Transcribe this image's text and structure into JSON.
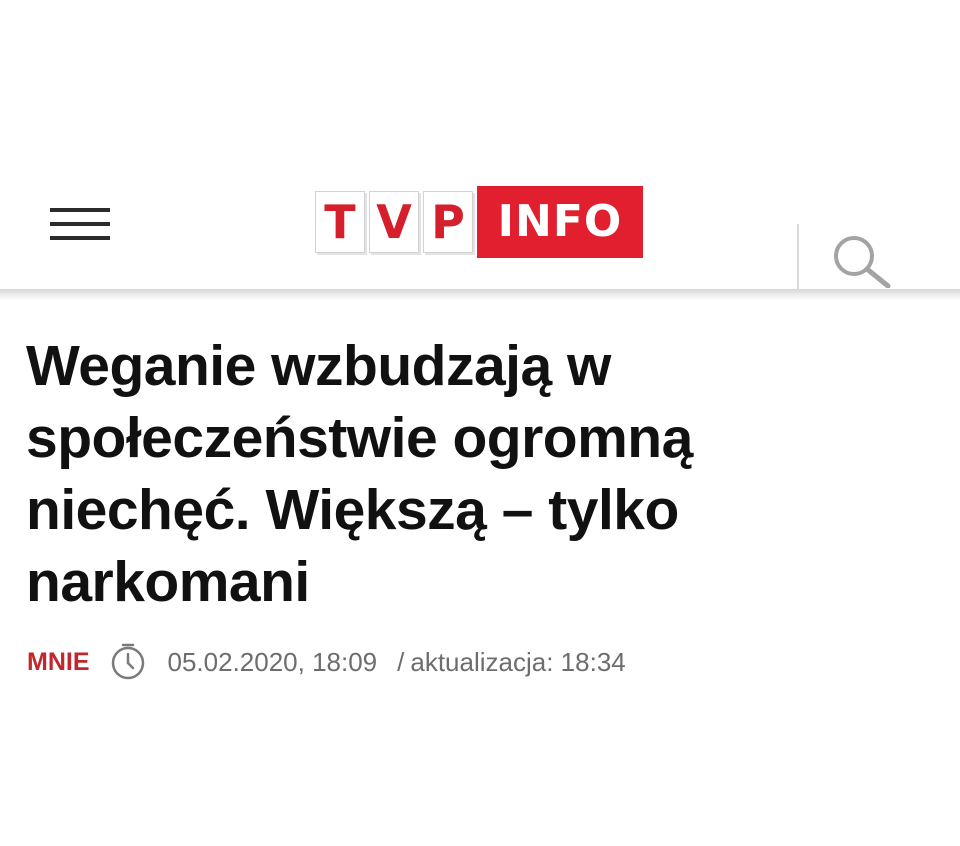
{
  "header": {
    "menu_icon": "hamburger-menu-icon",
    "logo": {
      "letters": [
        "T",
        "V",
        "P"
      ],
      "info": "INFO",
      "brand_red": "#e11f2e"
    },
    "search_icon": "search-icon"
  },
  "article": {
    "headline": "Weganie wzbudzają w społeczeństwie ogromną niechęć. Większą – tylko narkomani",
    "author": "MNIE",
    "clock_icon": "clock-icon",
    "published": "05.02.2020, 18:09",
    "separator": "/",
    "updated": "aktualizacja: 18:34",
    "author_color": "#c1272d"
  }
}
